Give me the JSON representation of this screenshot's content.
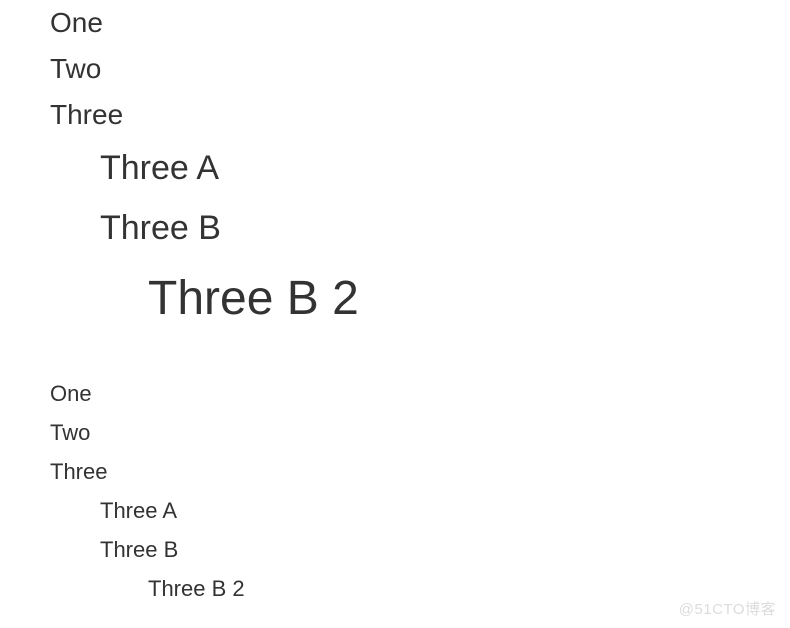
{
  "page": {
    "background_color": "#ffffff",
    "text_color": "#333333"
  },
  "blocks": [
    {
      "id": "block-one",
      "name": "nested-list-scaled",
      "description": "Nested bullet list where each deeper level is rendered in a progressively larger font size",
      "items": [
        {
          "label": "One",
          "level": 1,
          "bullet": "disc-bullet-icon",
          "font_size_px": 28
        },
        {
          "label": "Two",
          "level": 1,
          "bullet": "disc-bullet-icon",
          "font_size_px": 28
        },
        {
          "label": "Three",
          "level": 1,
          "bullet": "disc-bullet-icon",
          "font_size_px": 28
        },
        {
          "label": "Three A",
          "level": 2,
          "bullet": "circle-bullet-icon",
          "font_size_px": 34
        },
        {
          "label": "Three B",
          "level": 2,
          "bullet": "circle-bullet-icon",
          "font_size_px": 34
        },
        {
          "label": "Three B 2",
          "level": 3,
          "bullet": "square-bullet-icon",
          "font_size_px": 48
        }
      ]
    },
    {
      "id": "block-two",
      "name": "nested-list-uniform",
      "description": "Nested bullet list rendered at a single uniform font size for all levels",
      "items": [
        {
          "label": "One",
          "level": 1,
          "bullet": "disc-bullet-icon",
          "font_size_px": 22
        },
        {
          "label": "Two",
          "level": 1,
          "bullet": "disc-bullet-icon",
          "font_size_px": 22
        },
        {
          "label": "Three",
          "level": 1,
          "bullet": "disc-bullet-icon",
          "font_size_px": 22
        },
        {
          "label": "Three A",
          "level": 2,
          "bullet": "circle-bullet-icon",
          "font_size_px": 22
        },
        {
          "label": "Three B",
          "level": 2,
          "bullet": "circle-bullet-icon",
          "font_size_px": 22
        },
        {
          "label": "Three B 2",
          "level": 3,
          "bullet": "square-bullet-icon",
          "font_size_px": 22
        }
      ]
    }
  ],
  "watermark": {
    "text": "@51CTO博客",
    "color": "#dcdcdc"
  }
}
